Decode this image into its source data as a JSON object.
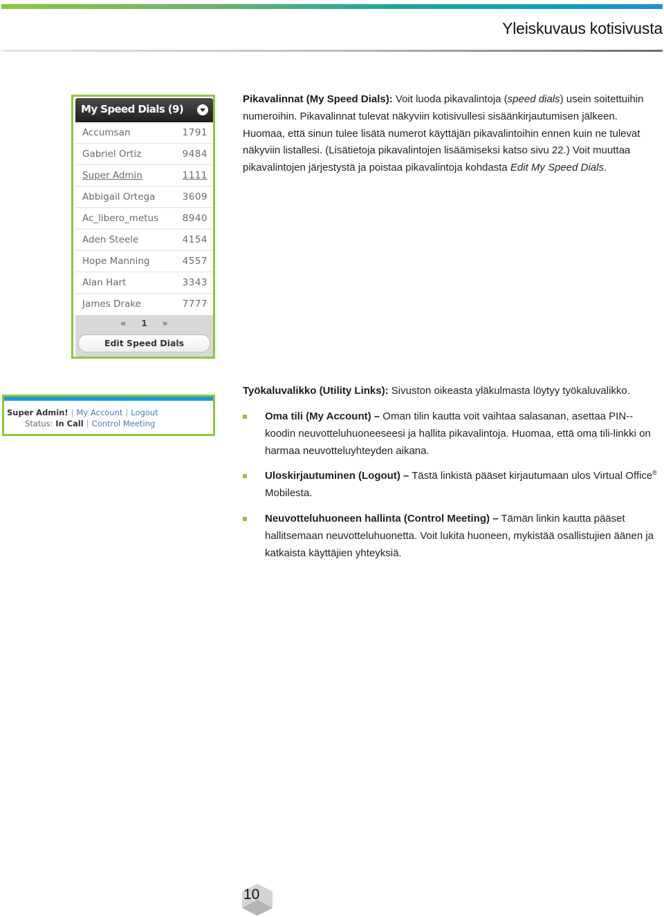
{
  "header": {
    "title": "Yleiskuvaus kotisivusta",
    "accent_gradient": [
      "#8dc63f",
      "#1aa79a",
      "#1b8fd8"
    ]
  },
  "speed_dials_widget": {
    "title": "My Speed Dials (9)",
    "toggle_icon": "chevron-down-circle",
    "entries": [
      {
        "name": "Accumsan",
        "number": "1791"
      },
      {
        "name": "Gabriel Ortiz",
        "number": "9484"
      },
      {
        "name": "Super Admin",
        "number": "1111",
        "linked": true
      },
      {
        "name": "Abbigail Ortega",
        "number": "3609"
      },
      {
        "name": "Ac_libero_metus",
        "number": "8940"
      },
      {
        "name": "Aden Steele",
        "number": "4154"
      },
      {
        "name": "Hope Manning",
        "number": "4557"
      },
      {
        "name": "Alan Hart",
        "number": "3343"
      },
      {
        "name": "James Drake",
        "number": "7777"
      }
    ],
    "pager": {
      "prev": "«",
      "page": "1",
      "next": "»"
    },
    "edit_button": "Edit Speed Dials",
    "frame_color": "#8cc63f"
  },
  "utility_links_widget": {
    "greeting": "Super Admin!",
    "my_account": "My Account",
    "logout": "Logout",
    "status_label": "Status:",
    "status_value": "In Call",
    "control_meeting": "Control Meeting",
    "separator": "|",
    "bar_color": "#1e9bd7"
  },
  "section_speed_dials": {
    "heading": "Pikavalinnat (My Speed Dials):",
    "text_1": " Voit luoda pikavalintoja (",
    "italic_1": "speed dials",
    "text_2": ") usein soitettuihin numeroihin. Pikavalinnat tulevat näkyviin kotisivullesi sisäänkirjautumisen jälkeen. Huomaa, että sinun tulee lisätä numerot käyttäjän pikavalintoihin ennen kuin ne tulevat näkyviin listallesi. (Lisätietoja pikavalintojen lisäämiseksi katso sivu 22.) Voit muuttaa pikavalintojen järjestystä ja poistaa pikavalintoja kohdasta ",
    "italic_2": "Edit My Speed Dials",
    "text_3": "."
  },
  "section_utility_links": {
    "heading": "Työkaluvalikko (Utility Links):",
    "text": " Sivuston oikeasta yläkulmasta löytyy työkaluvalikko.",
    "bullets": [
      {
        "term": "Oma tili (My Account) –",
        "text": " Oman tilin kautta voit vaihtaa salasanan, asettaa PIN--koodin neuvotteluhuoneeseesi ja hallita pikavalintoja. Huomaa, että oma tili-linkki on harmaa neuvotteluyhteyden aikana."
      },
      {
        "term": "Uloskirjautuminen (Logout) –",
        "text": " Tästä linkistä pääset kirjautumaan ulos Virtual Office",
        "sup": "®",
        "text_after": " Mobilesta."
      },
      {
        "term": "Neuvotteluhuoneen hallinta (Control Meeting) –",
        "text": " Tämän linkin kautta pääset hallitsemaan neuvotteluhuonetta. Voit lukita huoneen, mykistää osallistujien äänen ja katkaista käyttäjien yhteyksiä."
      }
    ],
    "bullet_color": "#8cc63f"
  },
  "footer": {
    "page_number": "10"
  }
}
